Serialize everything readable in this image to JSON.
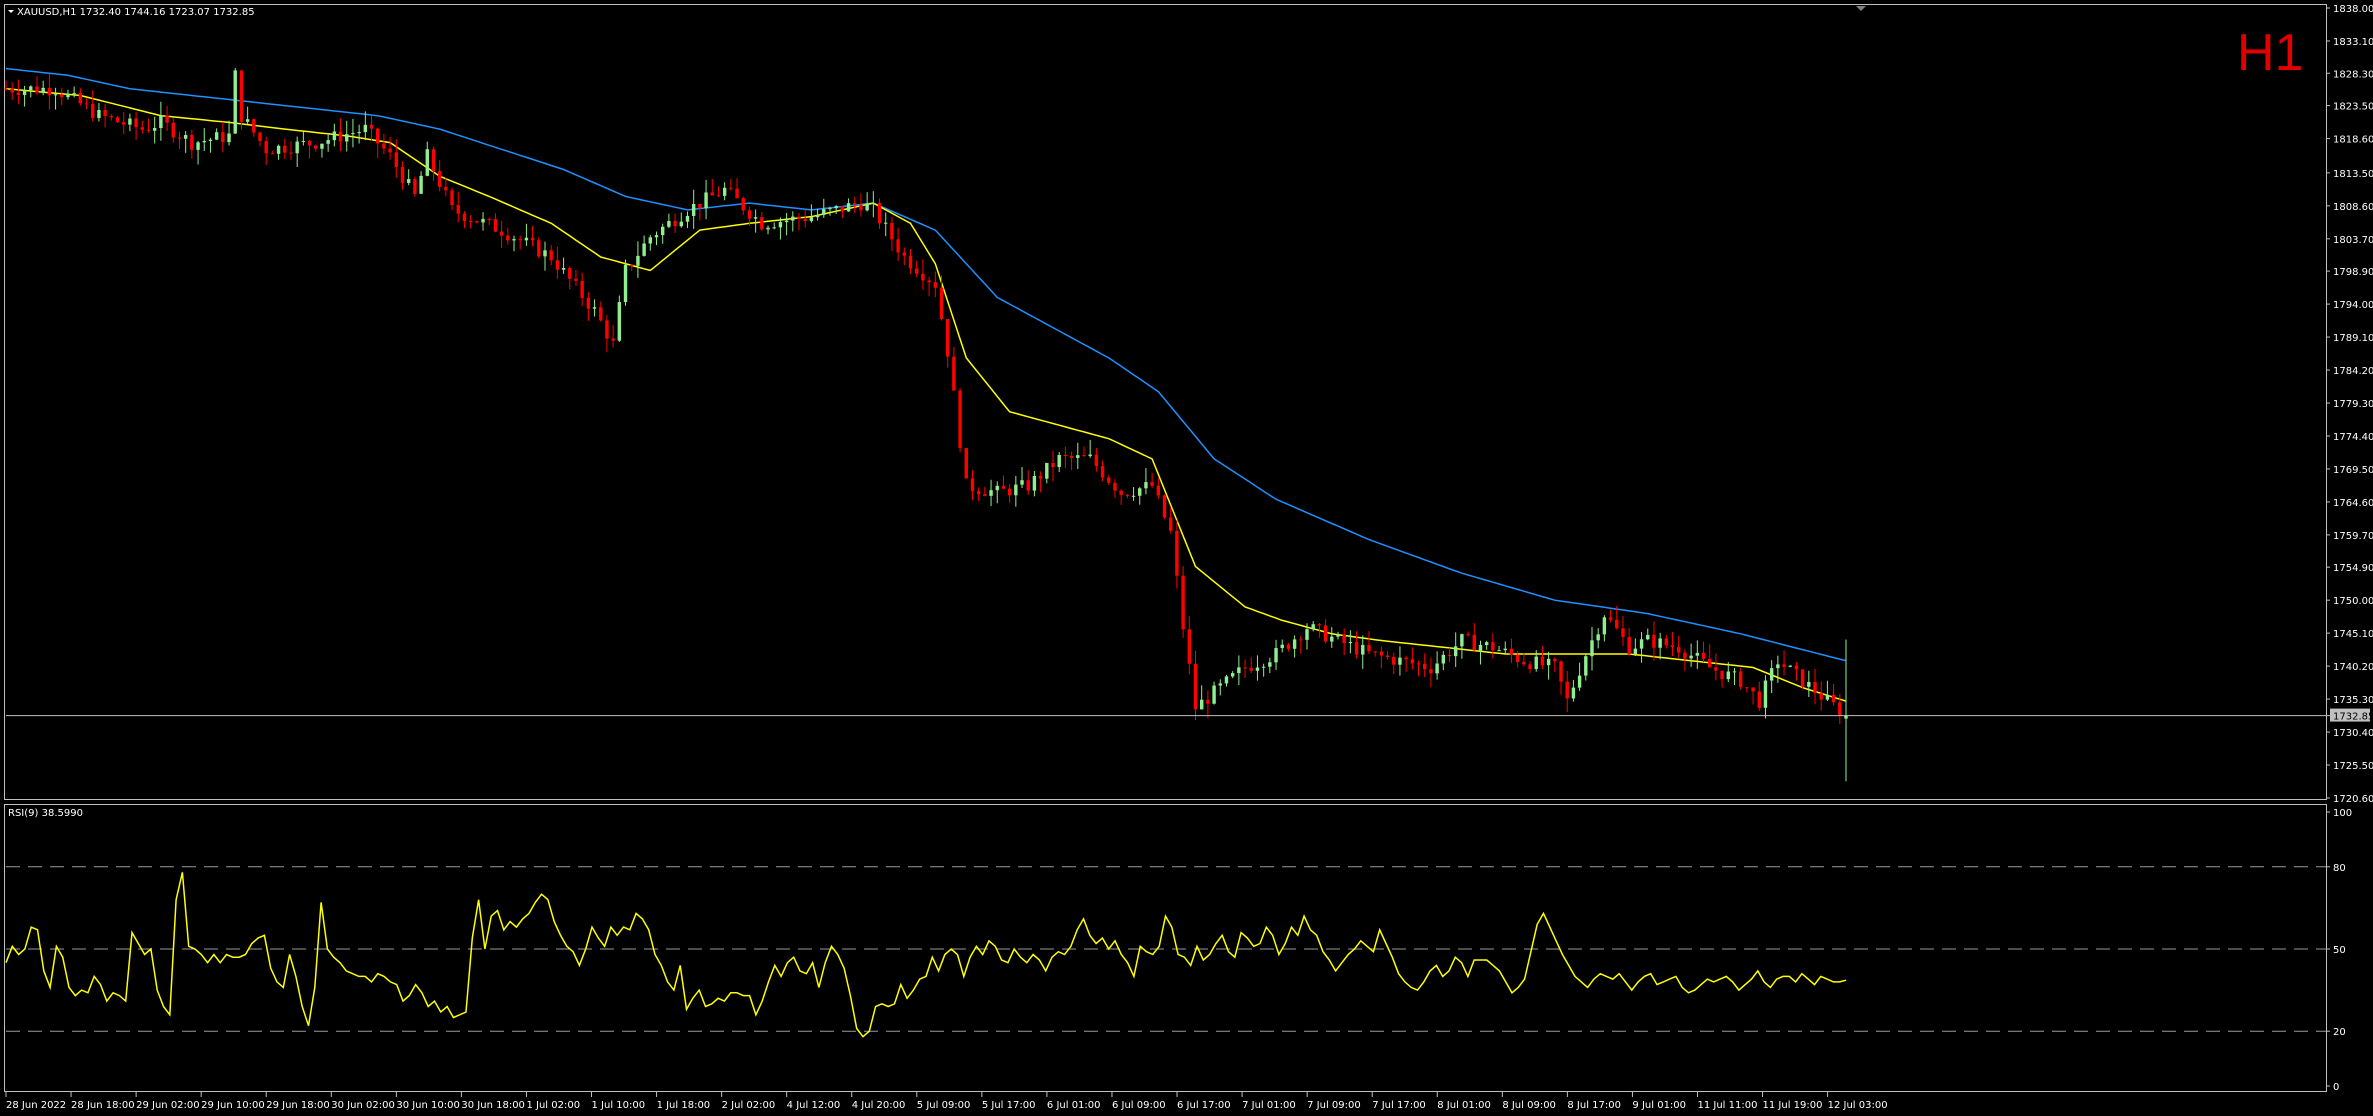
{
  "window": {
    "title": "XAUUSD,H1  1732.40 1744.16 1723.07 1732.85",
    "timeframe_label": "H1",
    "rsi_label": "RSI(9) 38.5990",
    "current_price_label": "1732.85"
  },
  "colors": {
    "background": "#000000",
    "bull": "#90ee90",
    "bear": "#ff0000",
    "ma_fast": "#ffff00",
    "ma_slow": "#1e90ff",
    "rsi": "#ffff00",
    "grid": "#c0c0c0",
    "timeframe": "#e00000"
  },
  "chart_data": [
    {
      "type": "candlestick",
      "symbol": "XAUUSD",
      "timeframe": "H1",
      "last": {
        "open": 1732.4,
        "high": 1744.16,
        "low": 1723.07,
        "close": 1732.85
      },
      "ylim": [
        1720.6,
        1838.0
      ],
      "y_ticks": [
        "1838.00",
        "1833.10",
        "1828.30",
        "1823.50",
        "1818.60",
        "1813.50",
        "1808.60",
        "1803.70",
        "1798.90",
        "1794.00",
        "1789.10",
        "1784.20",
        "1779.30",
        "1774.40",
        "1769.50",
        "1764.60",
        "1759.70",
        "1754.90",
        "1750.00",
        "1745.10",
        "1740.20",
        "1735.30",
        "1730.40",
        "1725.50",
        "1720.60"
      ],
      "x_ticks": [
        "28 Jun 2022",
        "28 Jun 18:00",
        "29 Jun 02:00",
        "29 Jun 10:00",
        "29 Jun 18:00",
        "30 Jun 02:00",
        "30 Jun 10:00",
        "30 Jun 18:00",
        "1 Jul 02:00",
        "1 Jul 10:00",
        "1 Jul 18:00",
        "2 Jul 02:00",
        "4 Jul 12:00",
        "4 Jul 20:00",
        "5 Jul 09:00",
        "5 Jul 17:00",
        "6 Jul 01:00",
        "6 Jul 09:00",
        "6 Jul 17:00",
        "7 Jul 01:00",
        "7 Jul 09:00",
        "7 Jul 17:00",
        "8 Jul 01:00",
        "8 Jul 09:00",
        "8 Jul 17:00",
        "9 Jul 01:00",
        "11 Jul 11:00",
        "11 Jul 19:00",
        "12 Jul 03:00"
      ],
      "close_anchors": [
        [
          0,
          1826
        ],
        [
          8,
          1826
        ],
        [
          15,
          1822
        ],
        [
          22,
          1820
        ],
        [
          25,
          1821
        ],
        [
          30,
          1818
        ],
        [
          36,
          1819
        ],
        [
          37,
          1828
        ],
        [
          38,
          1822
        ],
        [
          42,
          1817
        ],
        [
          50,
          1818
        ],
        [
          58,
          1820
        ],
        [
          62,
          1816
        ],
        [
          66,
          1810
        ],
        [
          68,
          1816
        ],
        [
          72,
          1808
        ],
        [
          80,
          1805
        ],
        [
          88,
          1801
        ],
        [
          95,
          1793
        ],
        [
          98,
          1788
        ],
        [
          100,
          1799
        ],
        [
          104,
          1804
        ],
        [
          110,
          1808
        ],
        [
          116,
          1811
        ],
        [
          122,
          1806
        ],
        [
          130,
          1807
        ],
        [
          138,
          1809
        ],
        [
          140,
          1808
        ],
        [
          145,
          1801
        ],
        [
          150,
          1797
        ],
        [
          152,
          1787
        ],
        [
          155,
          1767
        ],
        [
          160,
          1766
        ],
        [
          165,
          1767
        ],
        [
          170,
          1771
        ],
        [
          175,
          1771
        ],
        [
          180,
          1766
        ],
        [
          185,
          1767
        ],
        [
          188,
          1760
        ],
        [
          190,
          1746
        ],
        [
          192,
          1734
        ],
        [
          196,
          1737
        ],
        [
          200,
          1740
        ],
        [
          205,
          1742
        ],
        [
          210,
          1746
        ],
        [
          215,
          1744
        ],
        [
          220,
          1742
        ],
        [
          225,
          1741
        ],
        [
          230,
          1740
        ],
        [
          235,
          1744
        ],
        [
          240,
          1743
        ],
        [
          245,
          1741
        ],
        [
          250,
          1740
        ],
        [
          252,
          1735
        ],
        [
          255,
          1742
        ],
        [
          258,
          1748
        ],
        [
          262,
          1743
        ],
        [
          265,
          1744
        ],
        [
          270,
          1743
        ],
        [
          275,
          1740
        ],
        [
          280,
          1738
        ],
        [
          283,
          1735
        ],
        [
          286,
          1741
        ],
        [
          290,
          1738
        ],
        [
          294,
          1735
        ],
        [
          297,
          1732.85
        ]
      ],
      "ma_fast_anchors": [
        [
          0,
          1826
        ],
        [
          12,
          1825
        ],
        [
          25,
          1822
        ],
        [
          36,
          1821
        ],
        [
          45,
          1820
        ],
        [
          55,
          1819
        ],
        [
          62,
          1818
        ],
        [
          70,
          1813
        ],
        [
          78,
          1810
        ],
        [
          88,
          1806
        ],
        [
          96,
          1801
        ],
        [
          104,
          1799
        ],
        [
          112,
          1805
        ],
        [
          120,
          1806
        ],
        [
          130,
          1807
        ],
        [
          140,
          1809
        ],
        [
          146,
          1806
        ],
        [
          150,
          1800
        ],
        [
          155,
          1786
        ],
        [
          162,
          1778
        ],
        [
          170,
          1776
        ],
        [
          178,
          1774
        ],
        [
          185,
          1771
        ],
        [
          192,
          1755
        ],
        [
          200,
          1749
        ],
        [
          206,
          1747
        ],
        [
          214,
          1745
        ],
        [
          222,
          1744
        ],
        [
          232,
          1743
        ],
        [
          242,
          1742
        ],
        [
          252,
          1742
        ],
        [
          262,
          1742
        ],
        [
          272,
          1741
        ],
        [
          282,
          1740
        ],
        [
          290,
          1737
        ],
        [
          297,
          1735
        ]
      ],
      "ma_slow_anchors": [
        [
          0,
          1829
        ],
        [
          10,
          1828
        ],
        [
          20,
          1826
        ],
        [
          30,
          1825
        ],
        [
          40,
          1824
        ],
        [
          50,
          1823
        ],
        [
          60,
          1822
        ],
        [
          70,
          1820
        ],
        [
          80,
          1817
        ],
        [
          90,
          1814
        ],
        [
          100,
          1810
        ],
        [
          110,
          1808
        ],
        [
          120,
          1809
        ],
        [
          130,
          1808
        ],
        [
          140,
          1809
        ],
        [
          150,
          1805
        ],
        [
          160,
          1795
        ],
        [
          170,
          1790
        ],
        [
          178,
          1786
        ],
        [
          186,
          1781
        ],
        [
          195,
          1771
        ],
        [
          205,
          1765
        ],
        [
          220,
          1759
        ],
        [
          235,
          1754
        ],
        [
          250,
          1750
        ],
        [
          265,
          1748
        ],
        [
          280,
          1745
        ],
        [
          297,
          1741
        ]
      ]
    },
    {
      "type": "line",
      "name": "RSI(9)",
      "ylim": [
        0,
        100
      ],
      "levels": [
        20,
        50,
        80
      ],
      "y_ticks": [
        "100",
        "80",
        "50",
        "20",
        "0"
      ],
      "values": [
        45,
        51,
        48,
        50,
        58,
        57,
        42,
        36,
        51,
        47,
        36,
        33,
        35,
        34,
        40,
        37,
        31,
        34,
        33,
        31,
        56,
        52,
        48,
        50,
        35,
        29,
        26,
        68,
        78,
        51,
        50,
        48,
        45,
        48,
        45,
        48,
        47,
        47,
        48,
        52,
        54,
        55,
        43,
        38,
        36,
        48,
        40,
        29,
        22,
        36,
        67,
        50,
        47,
        45,
        42,
        41,
        40,
        40,
        38,
        41,
        40,
        38,
        37,
        31,
        33,
        37,
        34,
        29,
        31,
        27,
        29,
        25,
        26,
        27,
        54,
        68,
        50,
        62,
        64,
        57,
        60,
        58,
        61,
        63,
        67,
        70,
        68,
        60,
        55,
        51,
        49,
        44,
        50,
        58,
        54,
        51,
        58,
        55,
        58,
        57,
        63,
        61,
        57,
        48,
        44,
        38,
        35,
        44,
        28,
        32,
        35,
        29,
        30,
        32,
        31,
        34,
        34,
        33,
        33,
        26,
        31,
        38,
        44,
        40,
        45,
        47,
        42,
        41,
        45,
        36,
        45,
        51,
        48,
        43,
        33,
        21,
        18,
        20,
        29,
        30,
        29,
        30,
        37,
        32,
        35,
        39,
        40,
        47,
        42,
        48,
        50,
        48,
        40,
        47,
        51,
        48,
        53,
        51,
        46,
        45,
        50,
        47,
        45,
        48,
        46,
        42,
        47,
        49,
        48,
        51,
        57,
        61,
        55,
        52,
        54,
        50,
        53,
        48,
        45,
        40,
        51,
        49,
        48,
        51,
        62,
        58,
        48,
        47,
        44,
        51,
        46,
        48,
        52,
        55,
        49,
        47,
        56,
        54,
        51,
        52,
        58,
        55,
        48,
        52,
        58,
        55,
        62,
        57,
        55,
        49,
        46,
        42,
        45,
        48,
        50,
        53,
        51,
        49,
        57,
        52,
        47,
        41,
        38,
        36,
        35,
        38,
        42,
        44,
        40,
        42,
        47,
        45,
        40,
        46,
        46,
        46,
        44,
        42,
        38,
        34,
        36,
        39,
        49,
        59,
        63,
        58,
        53,
        48,
        44,
        40,
        38,
        36,
        39,
        41,
        40,
        39,
        41,
        38,
        35,
        38,
        40,
        41,
        37,
        38,
        39,
        40,
        36,
        34,
        35,
        37,
        39,
        38,
        39,
        40,
        38,
        35,
        37,
        39,
        42,
        38,
        36,
        39,
        40,
        40,
        38,
        41,
        39,
        37,
        40,
        39,
        38,
        38,
        38.6
      ]
    }
  ]
}
